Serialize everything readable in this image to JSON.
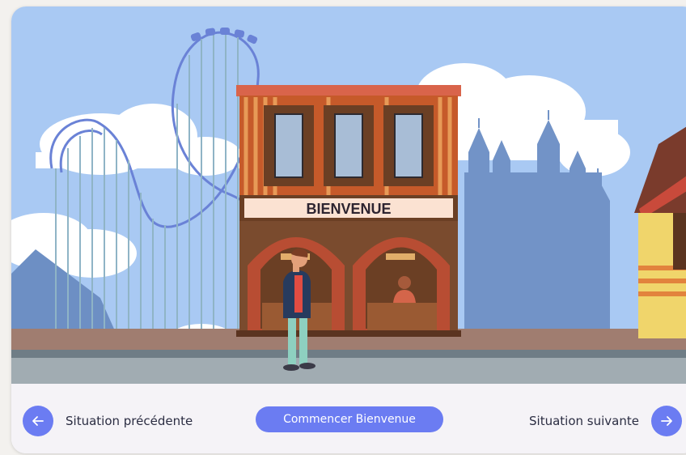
{
  "scene": {
    "sign_text": "BIENVENUE"
  },
  "navigation": {
    "prev_label": "Situation précédente",
    "start_label": "Commencer Bienvenue",
    "next_label": "Situation suivante"
  },
  "colors": {
    "accent": "#6b7cf2",
    "sky": "#a9c9f3",
    "building": "#c65a2a"
  }
}
